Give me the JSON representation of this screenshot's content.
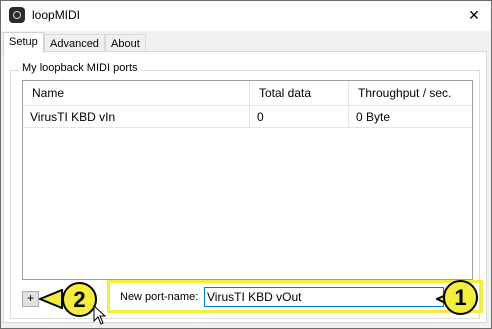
{
  "window": {
    "title": "loopMIDI",
    "close_glyph": "✕"
  },
  "tabs": [
    {
      "label": "Setup",
      "active": true
    },
    {
      "label": "Advanced",
      "active": false
    },
    {
      "label": "About",
      "active": false
    }
  ],
  "ports_group": {
    "label": "My loopback MIDI ports",
    "columns": [
      "Name",
      "Total data",
      "Throughput / sec."
    ],
    "rows": [
      [
        "VirusTI KBD vIn",
        "0",
        "0 Byte"
      ]
    ]
  },
  "add_button": {
    "label": "+"
  },
  "new_port": {
    "label": "New port-name:",
    "value": "VirusTI KBD vOut"
  },
  "callouts": {
    "one": "1",
    "two": "2",
    "color": "#f3ee3a"
  },
  "icons": {
    "app": "loopmidi-app-icon",
    "close": "close-icon",
    "cursor": "mouse-pointer-icon"
  }
}
